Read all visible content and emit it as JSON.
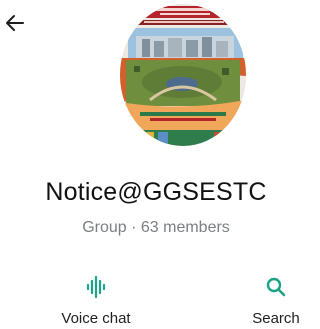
{
  "header": {
    "back_icon": "arrow-left-icon"
  },
  "group": {
    "name": "Notice@GGSESTC",
    "type": "Group",
    "separator": "·",
    "members": "63 members",
    "meta": "Group · 63 members",
    "avatar": "campus-poster-image"
  },
  "actions": {
    "voice_chat": {
      "label": "Voice chat",
      "icon": "waveform-icon"
    },
    "search": {
      "label": "Search",
      "icon": "search-icon"
    }
  },
  "colors": {
    "accent": "#1aa386",
    "text_primary": "#111111",
    "text_secondary": "#7a7f82",
    "background": "#ffffff"
  }
}
